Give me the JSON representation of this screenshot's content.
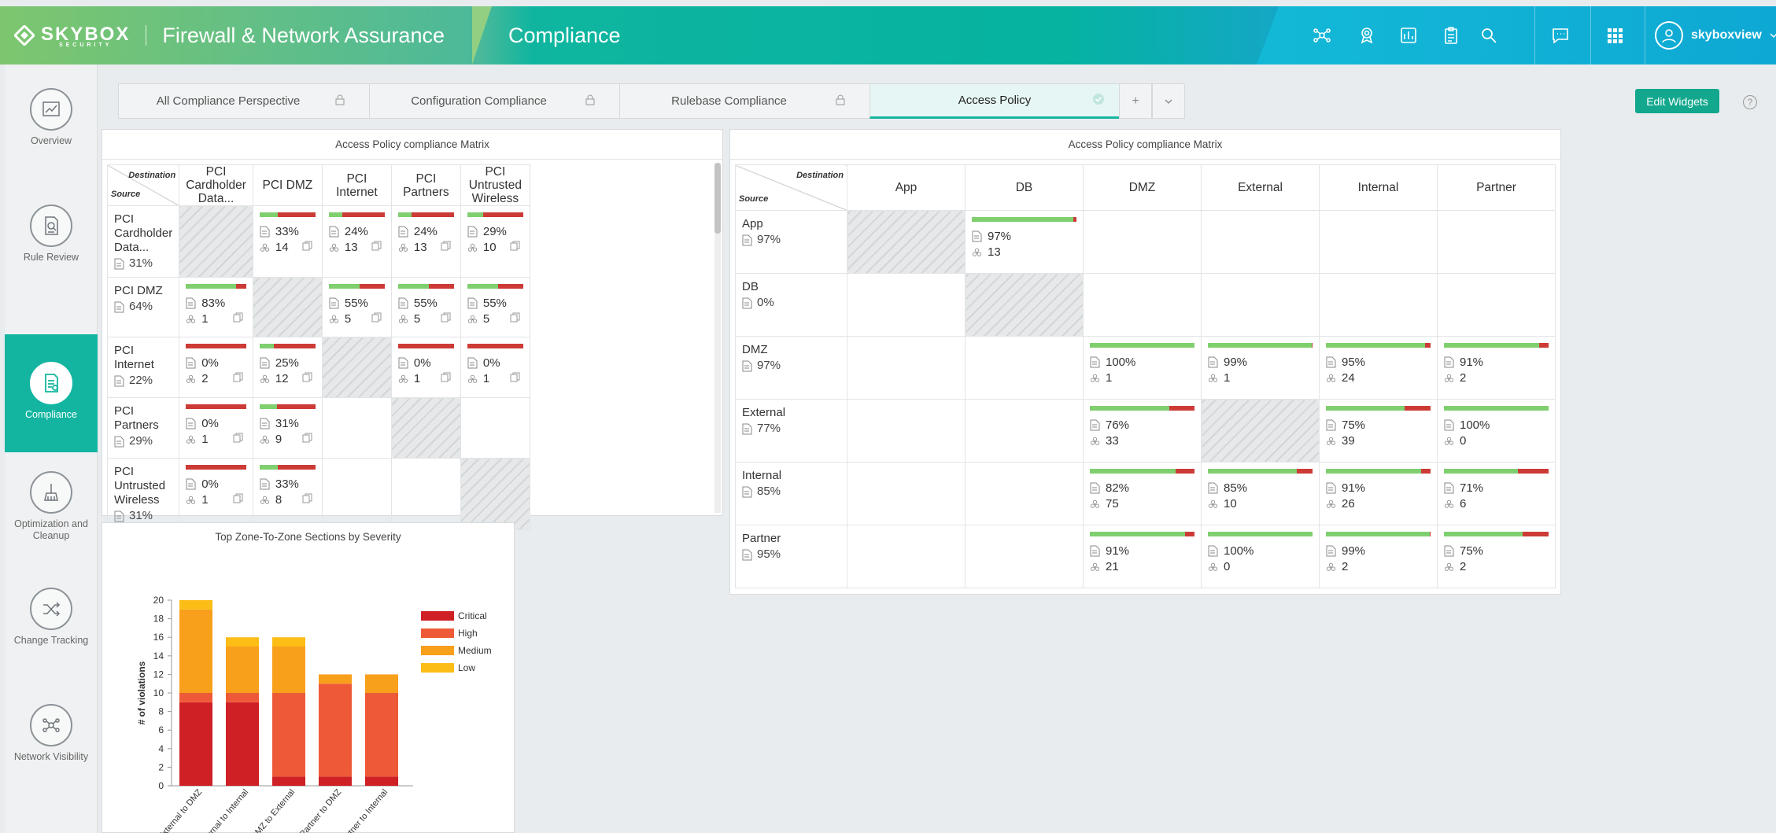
{
  "header": {
    "brand": "SKYBOX",
    "brand_sub": "SECURITY",
    "app_title": "Firewall & Network Assurance",
    "section": "Compliance",
    "username": "skyboxview",
    "icons": [
      "network-icon",
      "badge-icon",
      "dashboard-icon",
      "clipboard-icon",
      "search-icon",
      "chat-icon",
      "grid-icon",
      "user-icon"
    ]
  },
  "sidebar": {
    "items": [
      {
        "label": "Overview",
        "active": false
      },
      {
        "label": "Rule Review",
        "active": false
      },
      {
        "label": "Compliance",
        "active": true
      },
      {
        "label": "Optimization and Cleanup",
        "active": false
      },
      {
        "label": "Change Tracking",
        "active": false
      },
      {
        "label": "Network Visibility",
        "active": false
      }
    ]
  },
  "tabs": [
    {
      "label": "All Compliance Perspective",
      "active": false
    },
    {
      "label": "Configuration Compliance",
      "active": false
    },
    {
      "label": "Rulebase Compliance",
      "active": false
    },
    {
      "label": "Access Policy",
      "active": true
    }
  ],
  "tab_add": "+",
  "edit_widgets": "Edit Widgets",
  "help": "?",
  "matrix_labels": {
    "destination": "Destination",
    "source": "Source"
  },
  "matrix1": {
    "title": "Access Policy compliance Matrix",
    "columns": [
      "PCI Cardholder Data...",
      "PCI DMZ",
      "PCI Internet",
      "PCI Partners",
      "PCI Untrusted Wireless"
    ],
    "rows": [
      {
        "name": "PCI Cardholder Data...",
        "pct": "31%",
        "cells": [
          null,
          {
            "pct": "33%",
            "v": "14",
            "ok": 33
          },
          {
            "pct": "24%",
            "v": "13",
            "ok": 24
          },
          {
            "pct": "24%",
            "v": "13",
            "ok": 24
          },
          {
            "pct": "29%",
            "v": "10",
            "ok": 29
          }
        ]
      },
      {
        "name": "PCI DMZ",
        "pct": "64%",
        "cells": [
          {
            "pct": "83%",
            "v": "1",
            "ok": 83
          },
          null,
          {
            "pct": "55%",
            "v": "5",
            "ok": 55
          },
          {
            "pct": "55%",
            "v": "5",
            "ok": 55
          },
          {
            "pct": "55%",
            "v": "5",
            "ok": 55
          }
        ]
      },
      {
        "name": "PCI Internet",
        "pct": "22%",
        "cells": [
          {
            "pct": "0%",
            "v": "2",
            "ok": 0
          },
          {
            "pct": "25%",
            "v": "12",
            "ok": 25
          },
          null,
          {
            "pct": "0%",
            "v": "1",
            "ok": 0
          },
          {
            "pct": "0%",
            "v": "1",
            "ok": 0
          }
        ]
      },
      {
        "name": "PCI Partners",
        "pct": "29%",
        "cells": [
          {
            "pct": "0%",
            "v": "1",
            "ok": 0
          },
          {
            "pct": "31%",
            "v": "9",
            "ok": 31
          },
          "empty",
          null,
          "empty"
        ]
      },
      {
        "name": "PCI Untrusted Wireless",
        "pct": "31%",
        "cells": [
          {
            "pct": "0%",
            "v": "1",
            "ok": 0
          },
          {
            "pct": "33%",
            "v": "8",
            "ok": 33
          },
          "empty",
          "empty",
          null
        ]
      }
    ]
  },
  "matrix2": {
    "title": "Access Policy compliance Matrix",
    "columns": [
      "App",
      "DB",
      "DMZ",
      "External",
      "Internal",
      "Partner"
    ],
    "rows": [
      {
        "name": "App",
        "pct": "97%",
        "cells": [
          null,
          {
            "pct": "97%",
            "v": "13",
            "ok": 97
          },
          "empty",
          "empty",
          "empty",
          "empty"
        ]
      },
      {
        "name": "DB",
        "pct": "0%",
        "cells": [
          "empty",
          null,
          "empty",
          "empty",
          "empty",
          "empty"
        ]
      },
      {
        "name": "DMZ",
        "pct": "97%",
        "cells": [
          "empty",
          "empty",
          {
            "pct": "100%",
            "v": "1",
            "ok": 100
          },
          {
            "pct": "99%",
            "v": "1",
            "ok": 99
          },
          {
            "pct": "95%",
            "v": "24",
            "ok": 95
          },
          {
            "pct": "91%",
            "v": "2",
            "ok": 91
          }
        ]
      },
      {
        "name": "External",
        "pct": "77%",
        "cells": [
          "empty",
          "empty",
          {
            "pct": "76%",
            "v": "33",
            "ok": 76
          },
          null,
          {
            "pct": "75%",
            "v": "39",
            "ok": 75
          },
          {
            "pct": "100%",
            "v": "0",
            "ok": 100
          }
        ]
      },
      {
        "name": "Internal",
        "pct": "85%",
        "cells": [
          "empty",
          "empty",
          {
            "pct": "82%",
            "v": "75",
            "ok": 82
          },
          {
            "pct": "85%",
            "v": "10",
            "ok": 85
          },
          {
            "pct": "91%",
            "v": "26",
            "ok": 91
          },
          {
            "pct": "71%",
            "v": "6",
            "ok": 71
          }
        ]
      },
      {
        "name": "Partner",
        "pct": "95%",
        "cells": [
          "empty",
          "empty",
          {
            "pct": "91%",
            "v": "21",
            "ok": 91
          },
          {
            "pct": "100%",
            "v": "0",
            "ok": 100
          },
          {
            "pct": "99%",
            "v": "2",
            "ok": 99
          },
          {
            "pct": "75%",
            "v": "2",
            "ok": 75
          }
        ]
      }
    ]
  },
  "chart_data": {
    "type": "bar",
    "stacked": true,
    "title": "Top Zone-To-Zone Sections by Severity",
    "ylabel": "# of violations",
    "xlabel": "",
    "ylim": [
      0,
      20
    ],
    "yticks": [
      0,
      2,
      4,
      6,
      8,
      10,
      12,
      14,
      16,
      18,
      20
    ],
    "categories": [
      "NIST-External to DMZ",
      "NIST-External to Internal",
      "NIST-DMZ to External",
      "NIST-Partner to DMZ",
      "NIST-Partner to Internal"
    ],
    "series": [
      {
        "name": "Critical",
        "color": "#cf2025",
        "values": [
          9,
          9,
          1,
          1,
          1
        ]
      },
      {
        "name": "High",
        "color": "#ee5a37",
        "values": [
          1,
          1,
          9,
          10,
          9
        ]
      },
      {
        "name": "Medium",
        "color": "#f89f1b",
        "values": [
          9,
          5,
          5,
          1,
          2
        ]
      },
      {
        "name": "Low",
        "color": "#fbbd16",
        "values": [
          1,
          1,
          1,
          0,
          0
        ]
      }
    ],
    "legend": "top-right"
  }
}
